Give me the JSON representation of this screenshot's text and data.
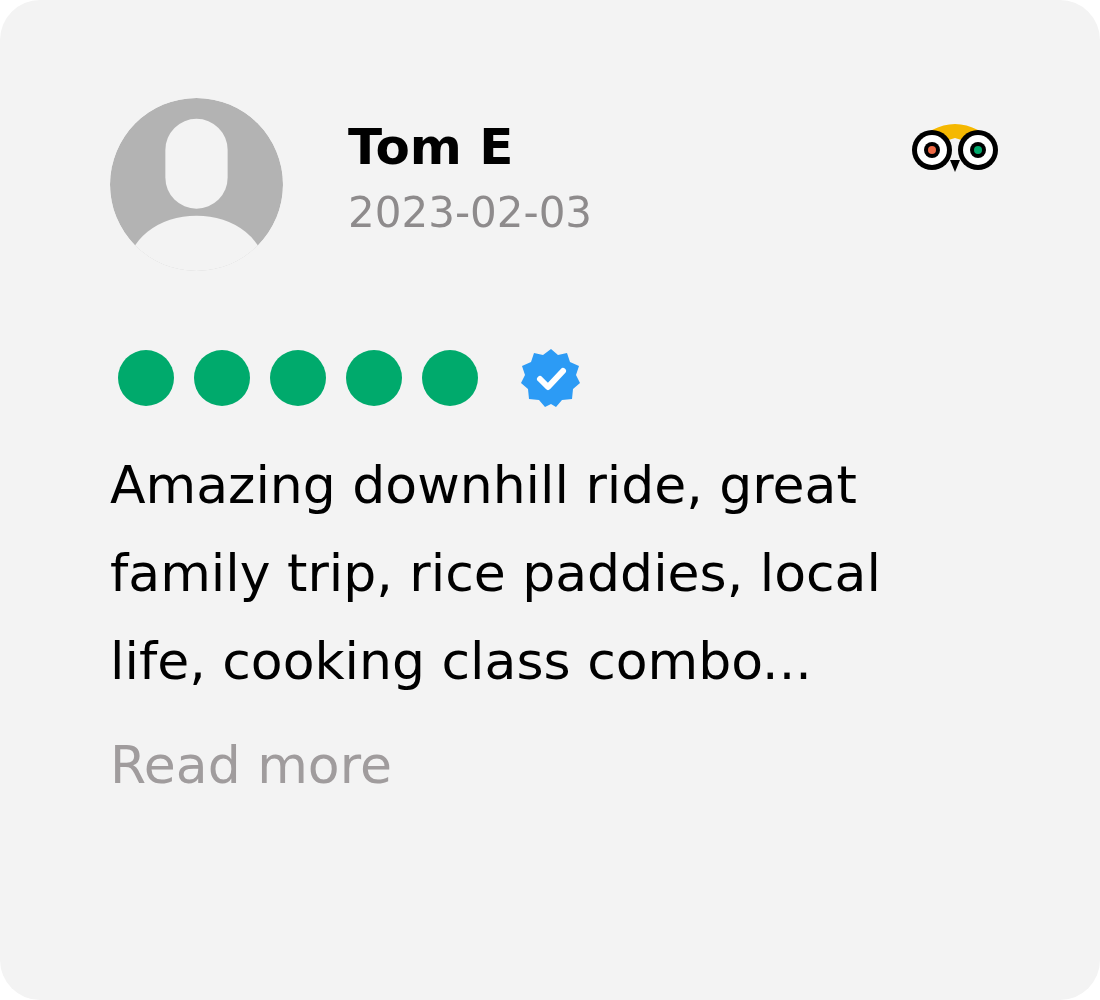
{
  "review": {
    "author": "Tom E",
    "date": "2023-02-03",
    "stars": 5,
    "verified": true,
    "text": "Amazing downhill ride, great family trip, rice paddies, local life, cooking class combo...",
    "read_more": "Read more"
  }
}
